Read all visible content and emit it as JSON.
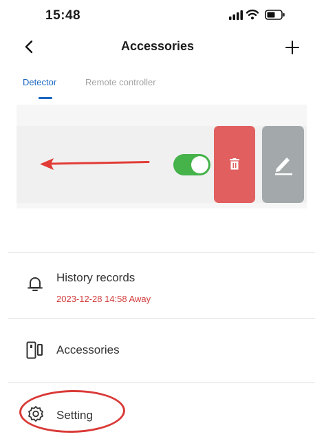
{
  "status_bar": {
    "time": "15:48"
  },
  "nav": {
    "title": "Accessories"
  },
  "tabs": [
    {
      "label": "Detector",
      "active": true
    },
    {
      "label": "Remote controller",
      "active": false
    }
  ],
  "device_row": {
    "toggle_on": true,
    "delete_icon": "trash-icon",
    "edit_icon": "pencil-icon"
  },
  "menu": {
    "history": {
      "label": "History records",
      "subtitle": "2023-12-28 14:58 Away",
      "icon": "bell-icon"
    },
    "accessories": {
      "label": "Accessories",
      "icon": "door-sensor-icon"
    },
    "setting": {
      "label": "Setting",
      "icon": "gear-icon"
    }
  },
  "colors": {
    "accent": "#1a66c2",
    "toggle_on": "#45b24a",
    "delete": "#e15f5f",
    "edit": "#a3a9ab",
    "annotation": "#d93a37"
  }
}
